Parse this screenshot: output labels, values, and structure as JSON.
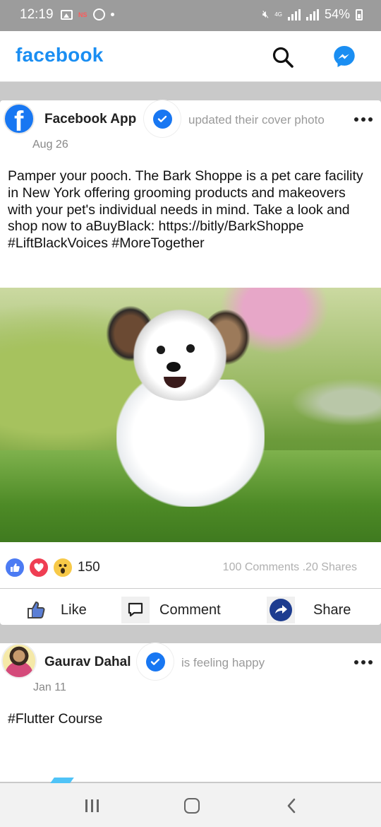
{
  "status_bar": {
    "time": "12:19",
    "ns_label": "NS",
    "network": "4G",
    "battery": "54%"
  },
  "app_bar": {
    "logo": "facebook",
    "search_icon": "search-icon",
    "messenger_icon": "messenger-icon"
  },
  "colors": {
    "brand": "#1a8ef2",
    "verified": "#1877f2",
    "like_reaction": "#4c7bf3",
    "love_reaction": "#ef3e53",
    "wow_reaction": "#f7c948",
    "share_icon": "#1d3c8f"
  },
  "posts": [
    {
      "author": "Facebook App",
      "action": "updated their cover photo",
      "date": "Aug 26",
      "text": "Pamper your pooch. The Bark Shoppe is a pet care facility in New York offering grooming products and makeovers with your pet's individual needs in mind. Take a look and shop now to aBuyBlack: https://bitly/BarkShoppe #LiftBlackVoices #MoreTogether",
      "reaction_count": "150",
      "stats": "100 Comments .20 Shares",
      "actions": {
        "like": "Like",
        "comment": "Comment",
        "share": "Share"
      }
    },
    {
      "author": "Gaurav Dahal",
      "action": "is feeling happy",
      "date": "Jan 11",
      "text": "#Flutter Course"
    }
  ]
}
